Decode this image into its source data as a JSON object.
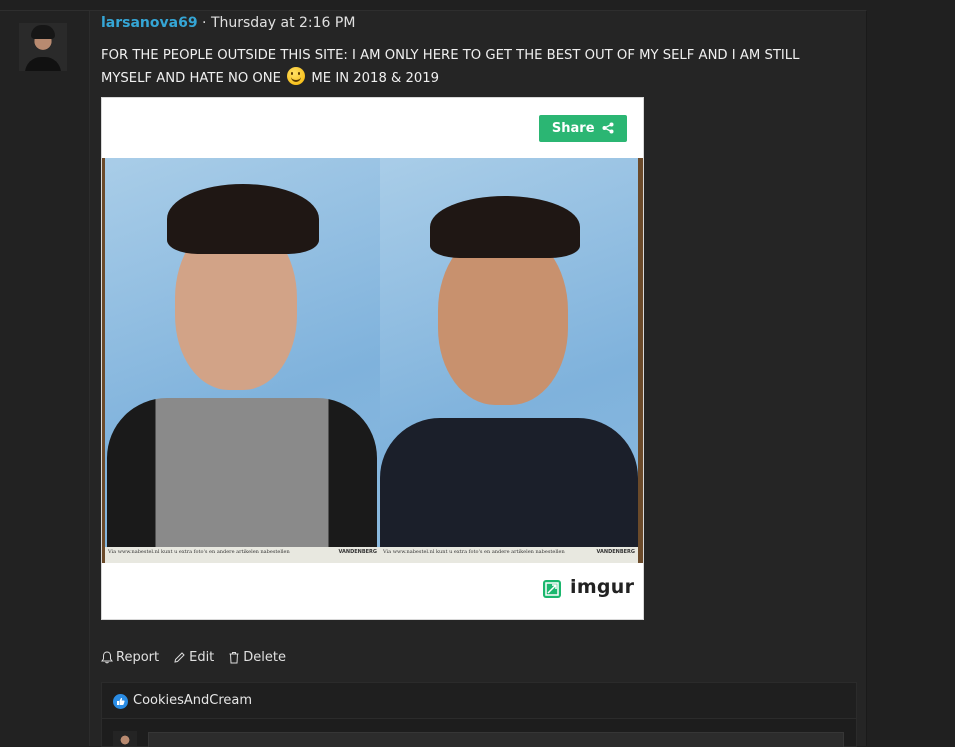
{
  "post": {
    "username": "larsanova69",
    "separator": "·",
    "timestamp": "Thursday at 2:16 PM",
    "message_part1": "FOR THE PEOPLE OUTSIDE THIS SITE: I AM ONLY HERE TO GET THE BEST OUT OF MY SELF AND I AM STILL MYSELF AND HATE NO ONE",
    "message_part2": "ME IN 2018 & 2019"
  },
  "embed": {
    "share_label": "Share",
    "provider": "imgur",
    "photo_strip_left": "Via www.nabestel.nl kunt u extra foto's en andere artikelen nabestellen",
    "photo_strip_right": "Via www.nabestel.nl kunt u extra foto's en andere artikelen nabestellen",
    "brand_left": "VANDENBERG",
    "brand_right": "VANDENBERG"
  },
  "actions": {
    "report": "Report",
    "edit": "Edit",
    "delete": "Delete"
  },
  "reactions": {
    "users": "CookiesAndCream"
  },
  "colors": {
    "username": "#35a6d6",
    "share_button": "#2bb673",
    "like": "#2a8ce4"
  }
}
